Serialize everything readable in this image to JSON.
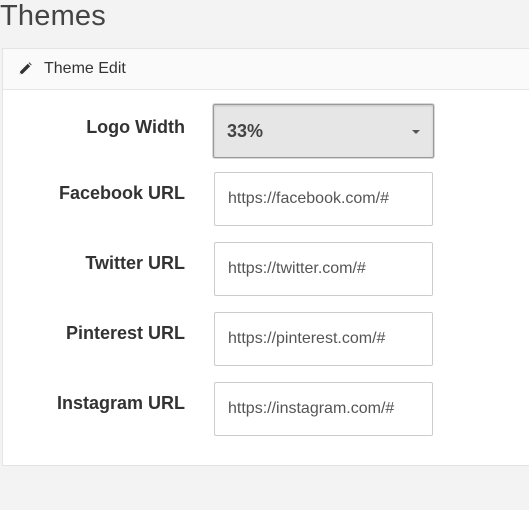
{
  "page": {
    "title": "Themes"
  },
  "panel": {
    "heading": "Theme Edit",
    "icon": "pencil-icon"
  },
  "form": {
    "logo_width": {
      "label": "Logo Width",
      "value": "33%"
    },
    "facebook": {
      "label": "Facebook URL",
      "value": "https://facebook.com/#"
    },
    "twitter": {
      "label": "Twitter URL",
      "value": "https://twitter.com/#"
    },
    "pinterest": {
      "label": "Pinterest URL",
      "value": "https://pinterest.com/#"
    },
    "instagram": {
      "label": "Instagram URL",
      "value": "https://instagram.com/#"
    }
  },
  "colors": {
    "page_background": "#f3f3f3",
    "panel_background": "#ffffff",
    "select_background": "#e6e6e6",
    "text": "#333333"
  }
}
